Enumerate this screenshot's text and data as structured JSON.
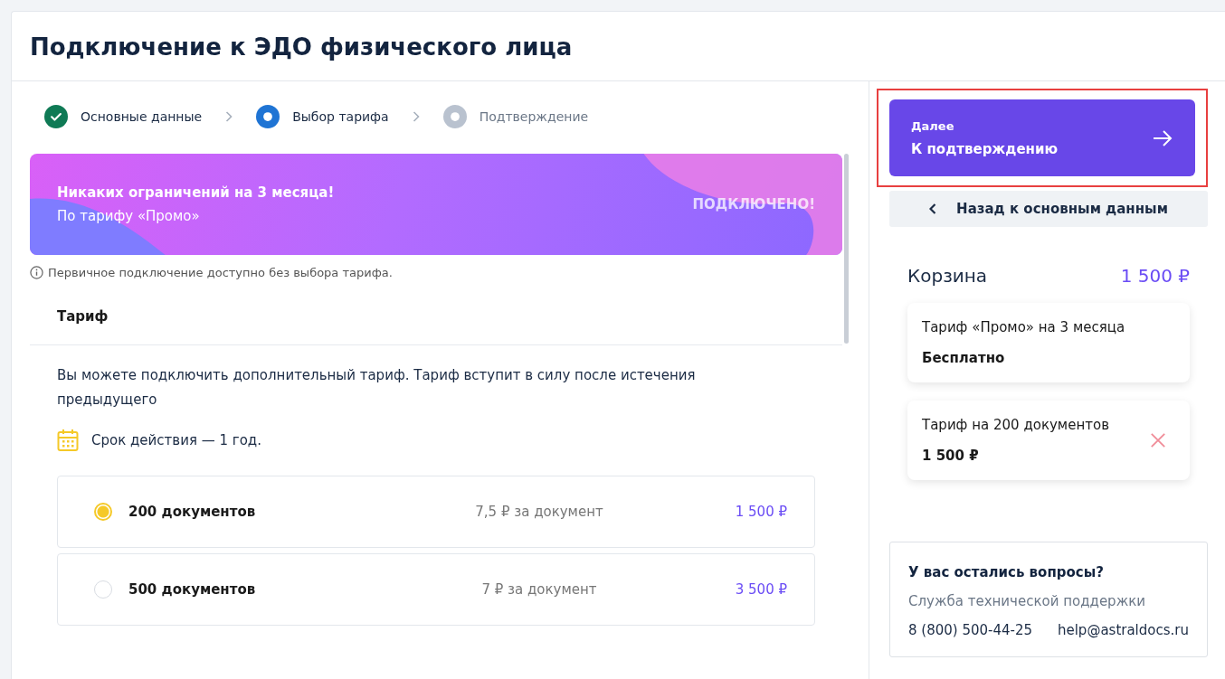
{
  "page": {
    "title": "Подключение к ЭДО физического лица"
  },
  "steps": [
    {
      "label": "Основные данные",
      "completed": true,
      "selected": false
    },
    {
      "label": "Выбор тарифа",
      "completed": false,
      "selected": true
    },
    {
      "label": "Подтверждение",
      "completed": false,
      "selected": false
    }
  ],
  "promo_banner": {
    "title": "Никаких ограничений на 3 месяца!",
    "subtitle": "По тарифу «Промо»",
    "badge": "ПОДКЛЮЧЕНО!"
  },
  "info_note": "Первичное подключение доступно без выбора тарифа.",
  "tariff_section": {
    "heading": "Тариф",
    "description": "Вы можете подключить дополнительный тариф. Тариф вступит в силу после истечения предыдущего",
    "validity": "Срок действия — 1 год.",
    "options": [
      {
        "name": "200 документов",
        "unit_price": "7,5 ₽ за документ",
        "price": "1 500 ₽",
        "selected": true
      },
      {
        "name": "500 документов",
        "unit_price": "7 ₽ за документ",
        "price": "3 500 ₽",
        "selected": false
      }
    ]
  },
  "next_button": {
    "caption": "Далее",
    "label": "К подтверждению",
    "highlighted": true
  },
  "back_button": {
    "label": "Назад к основным данным"
  },
  "cart": {
    "title": "Корзина",
    "total": "1 500 ₽",
    "items": [
      {
        "name": "Тариф «Промо» на 3 месяца",
        "price": "Бесплатно",
        "removable": false
      },
      {
        "name": "Тариф на 200 документов",
        "price": "1 500 ₽",
        "removable": true
      }
    ]
  },
  "support": {
    "title": "У вас остались вопросы?",
    "subtitle": "Служба технической поддержки",
    "phone": "8 (800) 500-44-25",
    "email": "help@astraldocs.ru"
  }
}
